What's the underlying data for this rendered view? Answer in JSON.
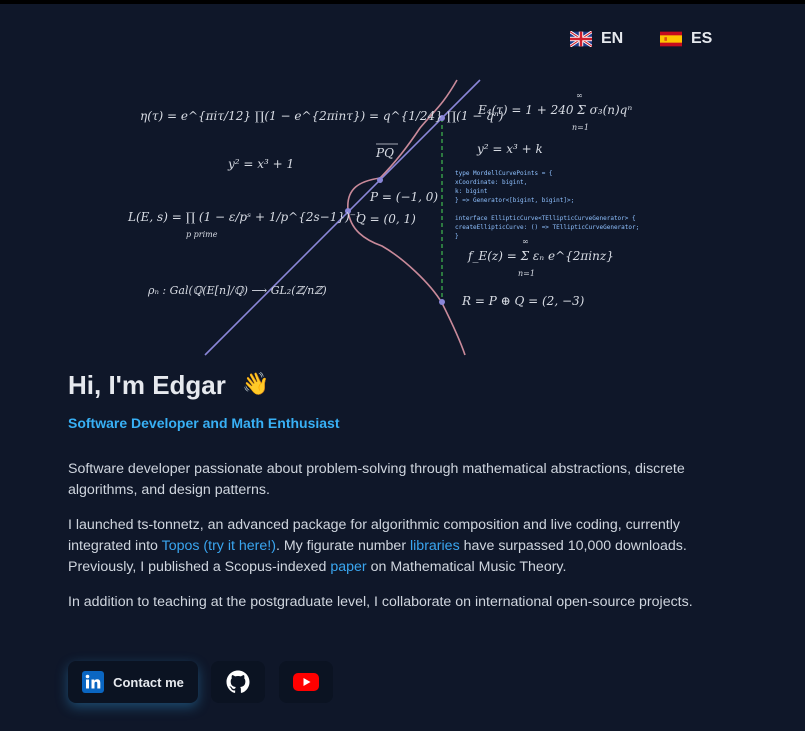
{
  "languages": [
    {
      "code": "EN",
      "flag": "uk-flag-icon"
    },
    {
      "code": "ES",
      "flag": "spain-flag-icon"
    }
  ],
  "hero_math": {
    "eta": "η(τ) = e^{πiτ/12} ∏(1 − e^{2πinτ}) = q^{1/24} ∏(1 − qⁿ)",
    "curve_left": "y² = x³ + 1",
    "lfunc": "L(E, s) = ∏ (1 − ε/pˢ + 1/p^{2s−1})⁻¹",
    "lfunc_sub": "p prime",
    "galois": "ρₙ : Gal(ℚ(E[n]/ℚ) ⟶ GL₂(ℤ/nℤ)",
    "pq": "PQ",
    "p_point": "P = (−1, 0)",
    "q_point": "Q = (0, 1)",
    "eisenstein": "E₄(τ) = 1 + 240 Σ σ₃(n)qⁿ",
    "curve_right": "y² = x³ + k",
    "code_lines": [
      "type MordellCurvePoints = {",
      "  xCoordinate: bigint,",
      "  k: bigint",
      "} => Generator<[bigint, bigint]>;",
      "interface EllipticCurve<TEllipticCurveGenerator> {",
      "  createEllipticCurve: () => TEllipticCurveGenerator;",
      "}"
    ],
    "fourier": "f_E(z) = Σ εₙ e^{2πinz}",
    "sum_sub": "n=1",
    "infinity": "∞",
    "result": "R = P ⊕ Q = (2, −3)"
  },
  "intro": {
    "title": "Hi, I'm Edgar",
    "emoji": "👋",
    "subtitle": "Software Developer and Math Enthusiast"
  },
  "paragraphs": {
    "p1": "Software developer passionate about problem-solving through mathematical abstractions, discrete algorithms, and design patterns.",
    "p2_a": "I launched ts-tonnetz, an advanced package for algorithmic composition and live coding, currently integrated into ",
    "p2_link1": "Topos (try it here!)",
    "p2_b": ". My figurate number ",
    "p2_link2": "libraries",
    "p2_c": " have surpassed 10,000 downloads. Previously, I published a Scopus-indexed ",
    "p2_link3": "paper",
    "p2_d": " on Mathematical Music Theory.",
    "p3": "In addition to teaching at the postgraduate level, I collaborate on international open-source projects."
  },
  "buttons": {
    "contact_label": "Contact me",
    "contact_icon": "linkedin-icon",
    "github_icon": "github-icon",
    "youtube_icon": "youtube-icon"
  },
  "colors": {
    "background": "#0f1729",
    "accent": "#38b0f5",
    "curve": "#c98a9a",
    "line": "#8a86d8",
    "dashed": "#3aa34a"
  }
}
